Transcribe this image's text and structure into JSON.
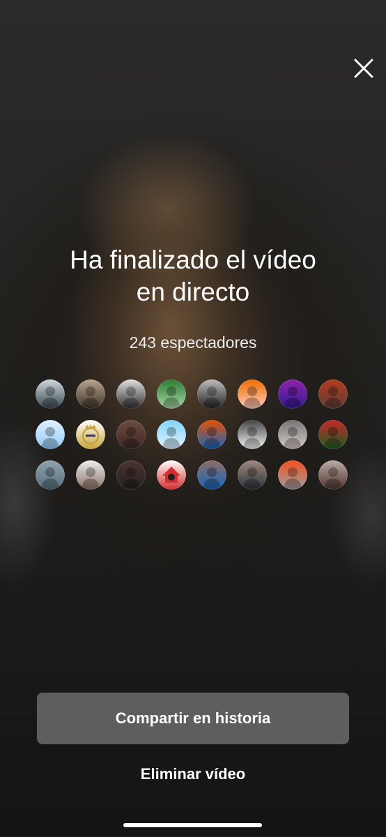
{
  "close": {
    "icon": "close-icon"
  },
  "live_ended": {
    "title_line1": "Ha finalizado el vídeo",
    "title_line2": "en directo",
    "viewers_text": "243 espectadores"
  },
  "viewer_avatars": [
    {
      "icon": "avatar-woman-selfie",
      "colors": [
        "#cfd8dc",
        "#37474f"
      ]
    },
    {
      "icon": "avatar-man-with-dog",
      "colors": [
        "#b7a48c",
        "#3e3328"
      ]
    },
    {
      "icon": "avatar-black-white-portrait",
      "colors": [
        "#e0e0e0",
        "#303030"
      ]
    },
    {
      "icon": "avatar-football-field",
      "colors": [
        "#2e7d32",
        "#a5d6a7"
      ]
    },
    {
      "icon": "avatar-mirror-selfie",
      "colors": [
        "#bdbdbd",
        "#212121"
      ]
    },
    {
      "icon": "avatar-orange-shirt",
      "colors": [
        "#ef6c00",
        "#ffccbc"
      ]
    },
    {
      "icon": "avatar-purple-lights",
      "colors": [
        "#8e24aa",
        "#311b92"
      ]
    },
    {
      "icon": "avatar-red-jersey",
      "colors": [
        "#b23b1f",
        "#5d4037"
      ]
    },
    {
      "icon": "avatar-white-jersey",
      "colors": [
        "#e3f2fd",
        "#90caf9"
      ]
    },
    {
      "icon": "real-madrid-crest-icon",
      "colors": [
        "#ffffff",
        "#c7a43a"
      ]
    },
    {
      "icon": "avatar-dark-portrait",
      "colors": [
        "#6d4c41",
        "#3e2723"
      ]
    },
    {
      "icon": "avatar-two-girls-blue",
      "colors": [
        "#81d4fa",
        "#e1f5fe"
      ]
    },
    {
      "icon": "avatar-team-photo",
      "colors": [
        "#e65100",
        "#1565c0"
      ]
    },
    {
      "icon": "avatar-dark-figure",
      "colors": [
        "#424242",
        "#fafafa"
      ]
    },
    {
      "icon": "avatar-group-photo",
      "colors": [
        "#757575",
        "#d7ccc8"
      ]
    },
    {
      "icon": "avatar-red-team",
      "colors": [
        "#c62828",
        "#1b5e20"
      ]
    },
    {
      "icon": "avatar-mascot",
      "colors": [
        "#90a4ae",
        "#546e7a"
      ]
    },
    {
      "icon": "avatar-player-white",
      "colors": [
        "#eceff1",
        "#8d6e63"
      ]
    },
    {
      "icon": "avatar-dark-girl",
      "colors": [
        "#4e342e",
        "#212121"
      ]
    },
    {
      "icon": "house-logo-icon",
      "colors": [
        "#ffffff",
        "#d32f2f"
      ]
    },
    {
      "icon": "avatar-player-field",
      "colors": [
        "#8d6e63",
        "#1565c0"
      ]
    },
    {
      "icon": "avatar-girl-glasses",
      "colors": [
        "#a1887f",
        "#263238"
      ]
    },
    {
      "icon": "avatar-kid-orange",
      "colors": [
        "#f4511e",
        "#9e9e9e"
      ]
    },
    {
      "icon": "avatar-sepia-portrait",
      "colors": [
        "#bcaaa4",
        "#4e342e"
      ]
    }
  ],
  "actions": {
    "share_label": "Compartir en historia",
    "delete_label": "Eliminar vídeo"
  }
}
